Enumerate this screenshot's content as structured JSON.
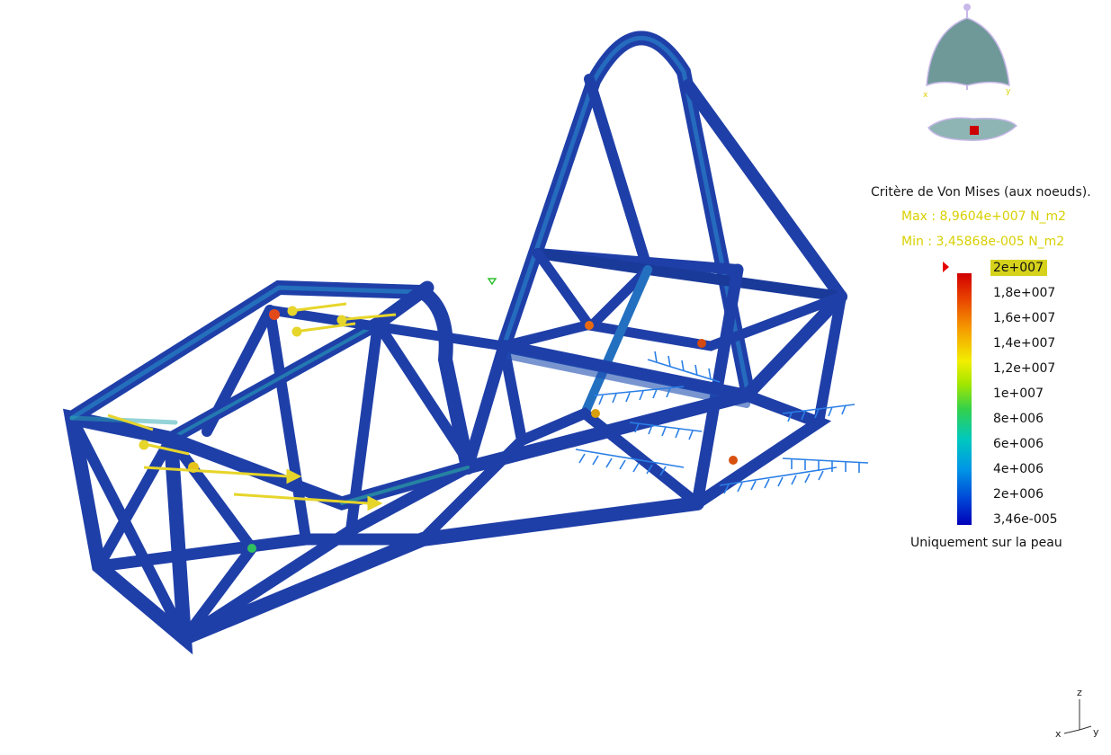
{
  "legend": {
    "title": "Critère de Von Mises (aux noeuds).",
    "max": "Max : 8,9604e+007 N_m2",
    "min": "Min : 3,45868e-005 N_m2",
    "ticks": [
      "2e+007",
      "1,8e+007",
      "1,6e+007",
      "1,4e+007",
      "1,2e+007",
      "1e+007",
      "8e+006",
      "6e+006",
      "4e+006",
      "2e+006",
      "3,46e-005"
    ],
    "footer": "Uniquement sur la peau",
    "colors": {
      "high": "#d10000",
      "mid": "#f2ee00",
      "low": "#0000b8",
      "highlight": "#d6d21b",
      "max_min_text": "#d8d000"
    }
  },
  "triad": {
    "z": "z",
    "x": "x",
    "y": "y"
  },
  "compass": {
    "x": "x",
    "y": "y"
  },
  "model": {
    "tube_color": "#1f3fa8",
    "load_arrow_color": "#e6d52a",
    "clamp_color": "#2a7fe6"
  }
}
